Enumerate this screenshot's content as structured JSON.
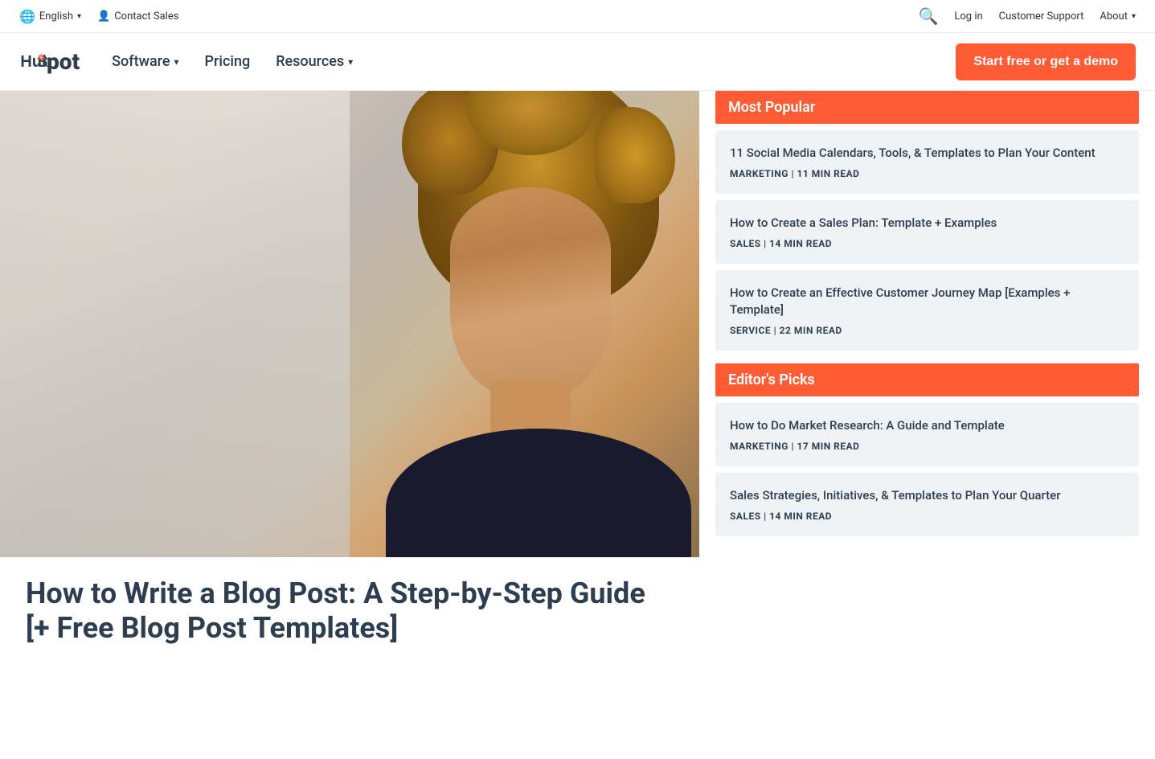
{
  "topbar": {
    "language": "English",
    "contact_sales": "Contact Sales",
    "login": "Log in",
    "customer_support": "Customer Support",
    "about": "About"
  },
  "nav": {
    "logo": "HubSpot",
    "links": [
      {
        "label": "Software",
        "has_dropdown": true
      },
      {
        "label": "Pricing",
        "has_dropdown": false
      },
      {
        "label": "Resources",
        "has_dropdown": true
      }
    ],
    "cta": "Start free or get a demo"
  },
  "featured": {
    "title": "How to Write a Blog Post: A Step-by-Step Guide [+ Free Blog Post Templates]"
  },
  "sidebar": {
    "most_popular_label": "Most Popular",
    "editors_picks_label": "Editor's Picks",
    "most_popular_items": [
      {
        "title": "11 Social Media Calendars, Tools, & Templates to Plan Your Content",
        "category": "MARKETING",
        "read_time": "11 MIN READ"
      },
      {
        "title": "How to Create a Sales Plan: Template + Examples",
        "category": "SALES",
        "read_time": "14 MIN READ"
      },
      {
        "title": "How to Create an Effective Customer Journey Map [Examples + Template]",
        "category": "SERVICE",
        "read_time": "22 MIN READ"
      }
    ],
    "editors_picks_items": [
      {
        "title": "How to Do Market Research: A Guide and Template",
        "category": "MARKETING",
        "read_time": "17 MIN READ"
      },
      {
        "title": "Sales Strategies, Initiatives, & Templates to Plan Your Quarter",
        "category": "SALES",
        "read_time": "14 MIN READ"
      }
    ]
  }
}
